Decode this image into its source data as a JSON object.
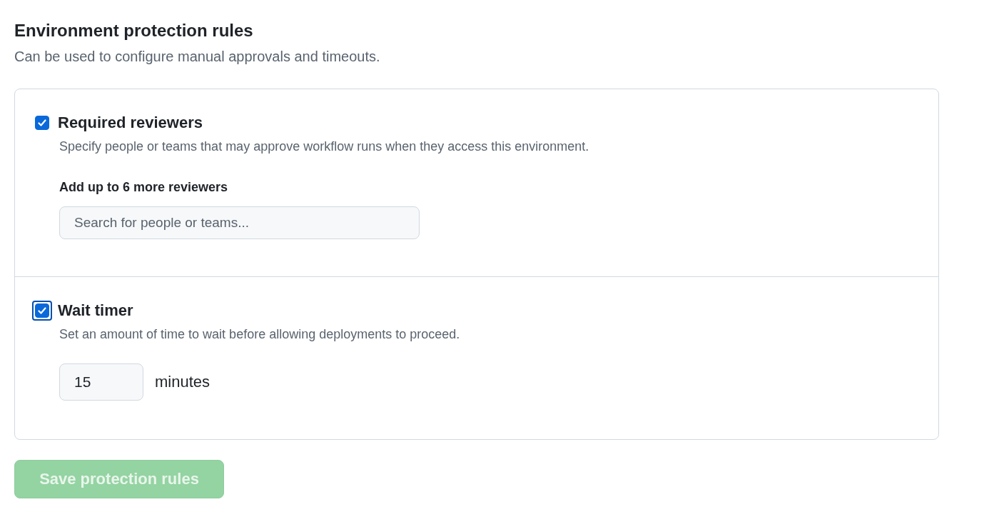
{
  "heading": "Environment protection rules",
  "subheading": "Can be used to configure manual approvals and timeouts.",
  "rules": [
    {
      "kind": "reviewers",
      "label": "Required reviewers",
      "checked": true,
      "focused": false,
      "description": "Specify people or teams that may approve workflow runs when they access this environment.",
      "field_label": "Add up to 6 more reviewers",
      "placeholder": "Search for people or teams..."
    },
    {
      "kind": "timer",
      "label": "Wait timer",
      "checked": true,
      "focused": true,
      "description": "Set an amount of time to wait before allowing deployments to proceed.",
      "value": "15",
      "unit": "minutes"
    }
  ],
  "save_button": {
    "label": "Save protection rules",
    "disabled": true
  }
}
